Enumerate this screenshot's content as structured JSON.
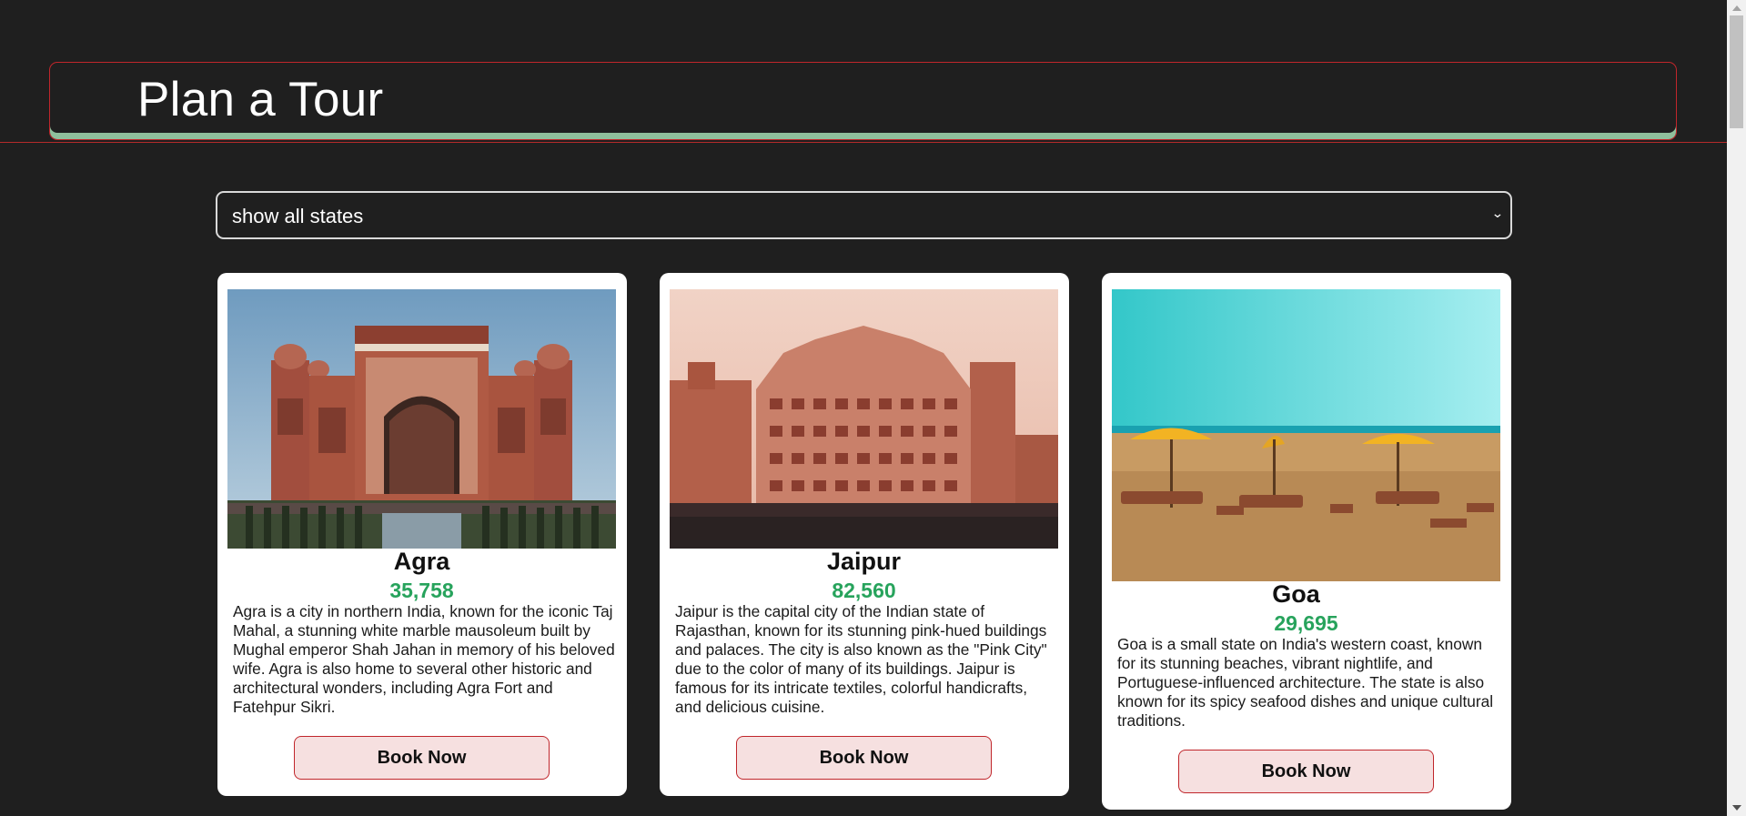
{
  "header": {
    "title": "Plan a Tour"
  },
  "filter": {
    "selected": "show all states",
    "icon": "chevron-down-icon"
  },
  "cards": [
    {
      "name": "Agra",
      "price": "35,758",
      "description": "Agra is a city in northern India, known for the iconic Taj Mahal, a stunning white marble mausoleum built by Mughal emperor Shah Jahan in memory of his beloved wife. Agra is also home to several other historic and architectural wonders, including Agra Fort and Fatehpur Sikri.",
      "button": "Book Now"
    },
    {
      "name": "Jaipur",
      "price": "82,560",
      "description": "Jaipur is the capital city of the Indian state of Rajasthan, known for its stunning pink-hued buildings and palaces. The city is also known as the \"Pink City\" due to the color of many of its buildings. Jaipur is famous for its intricate textiles, colorful handicrafts, and delicious cuisine.",
      "button": "Book Now"
    },
    {
      "name": "Goa",
      "price": "29,695",
      "description": "Goa is a small state on India's western coast, known for its stunning beaches, vibrant nightlife, and Portuguese-influenced architecture. The state is also known for its spicy seafood dishes and unique cultural traditions.",
      "button": "Book Now"
    }
  ],
  "colors": {
    "background": "#1f1f1f",
    "accent_border": "#c0262b",
    "header_underline": "#8fbf9c",
    "price": "#27a35c",
    "button_bg": "#f6e0e0"
  }
}
